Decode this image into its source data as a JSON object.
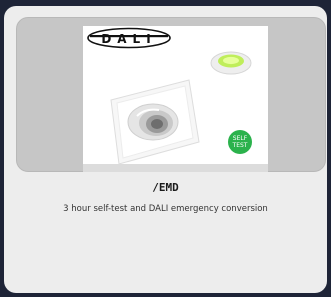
{
  "card": {
    "logo_text": "DALI",
    "badge": {
      "line1": "SELF",
      "line2": "TEST"
    },
    "product_code": "/EMD",
    "description": "3 hour self-test and DALI emergency conversion"
  },
  "colors": {
    "background": "#1e2437",
    "card": "#ededed",
    "image_panel": "#c6c6c6",
    "badge": "#2bb24c",
    "lamp_glow": "#9be23a"
  }
}
